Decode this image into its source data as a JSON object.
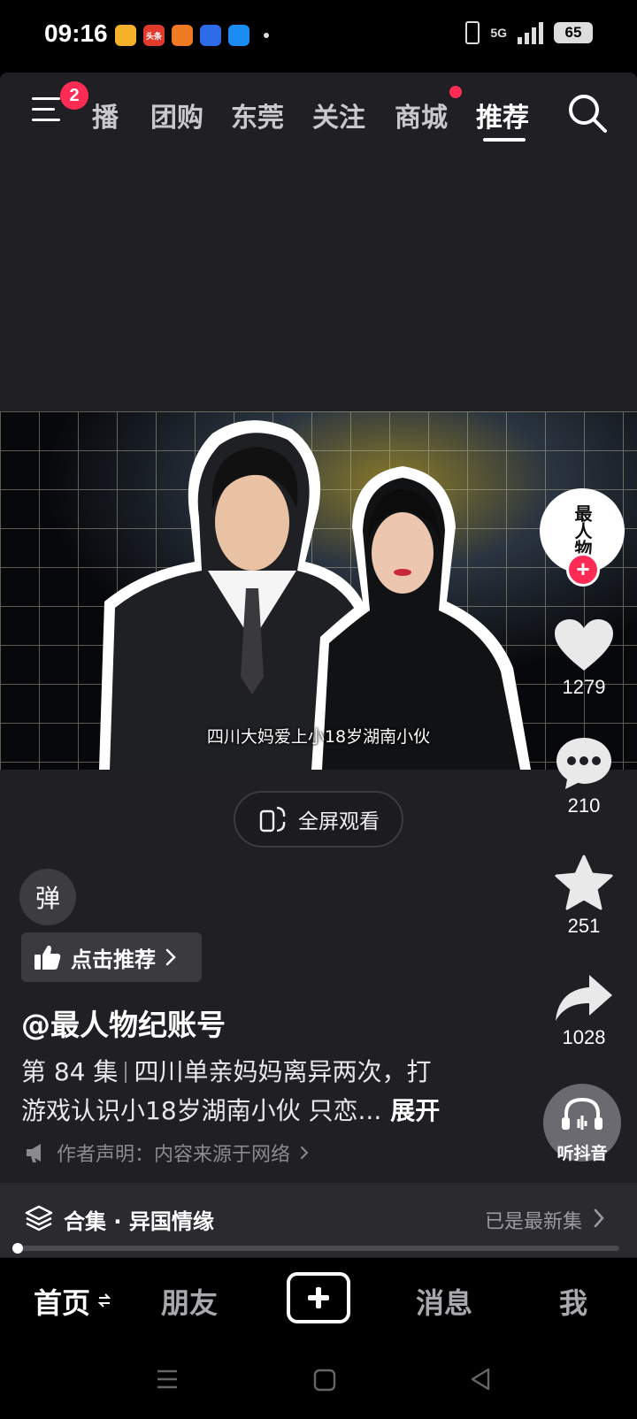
{
  "status_bar": {
    "time": "09:16",
    "apps": [
      "",
      "头条",
      "",
      "",
      ""
    ],
    "network": "5G",
    "battery": "65"
  },
  "top_nav": {
    "menu_badge": "2",
    "tabs": [
      "播",
      "团购",
      "东莞",
      "关注",
      "商城",
      "推荐"
    ],
    "active_tab": "推荐"
  },
  "video": {
    "caption": "四川大妈爱上小18岁湖南小伙",
    "fullscreen_label": "全屏观看"
  },
  "side_rail": {
    "avatar_text": "最人物",
    "follow_label": "+",
    "likes": "1279",
    "comments": "210",
    "favorites": "251",
    "shares": "1028",
    "listen_label": "听抖音"
  },
  "info": {
    "danmaku_label": "弹",
    "recommend_label": "点击推荐",
    "author": "@最人物纪账号",
    "episode": "第 84 集",
    "desc_line1": "四川单亲妈妈离异两次，打",
    "desc_line2": "游戏认识小18岁湖南小伙 只恋...",
    "expand_label": "展开",
    "disclaimer": "作者声明：内容来源于网络"
  },
  "collection": {
    "title": "合集 · 异国情缘",
    "status": "已是最新集"
  },
  "bottom_tabs": {
    "home": "首页",
    "friends": "朋友",
    "messages": "消息",
    "me": "我"
  },
  "colors": {
    "accent": "#fe2c55",
    "background": "#202024"
  }
}
